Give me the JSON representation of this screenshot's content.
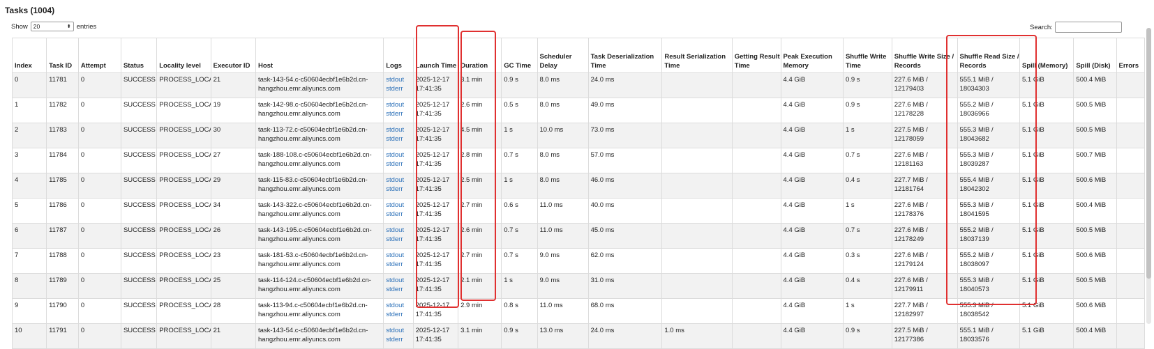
{
  "title": "Tasks (1004)",
  "show_label": "Show",
  "page_size": "20",
  "entries_label": "entries",
  "search_label": "Search:",
  "search_value": "",
  "columns": [
    "Index",
    "Task ID",
    "Attempt",
    "Status",
    "Locality level",
    "Executor ID",
    "Host",
    "Logs",
    "Launch Time",
    "Duration",
    "GC Time",
    "Scheduler Delay",
    "Task Deserialization Time",
    "Result Serialization Time",
    "Getting Result Time",
    "Peak Execution Memory",
    "Shuffle Write Time",
    "Shuffle Write Size / Records",
    "Shuffle Read Size / Records",
    "Spill (Memory)",
    "Spill (Disk)",
    "Errors"
  ],
  "rows": [
    {
      "index": "0",
      "task_id": "11781",
      "attempt": "0",
      "status": "SUCCESS",
      "locality": "PROCESS_LOCAL",
      "executor": "21",
      "host": "task-143-54.c-c50604ecbf1e6b2d.cn-hangzhou.emr.aliyuncs.com",
      "stdout": "stdout",
      "stderr": "stderr",
      "launch": "2025-12-17 17:41:35",
      "duration": "3.1 min",
      "gc": "0.9 s",
      "sched": "8.0 ms",
      "deser": "24.0 ms",
      "resser": "",
      "getting": "",
      "peak": "4.4 GiB",
      "swtime": "0.9 s",
      "swsize": "227.6 MiB / 12179403",
      "srsize": "555.1 MiB / 18034303",
      "spillmem": "5.1 GiB",
      "spilldisk": "500.4 MiB",
      "errors": ""
    },
    {
      "index": "1",
      "task_id": "11782",
      "attempt": "0",
      "status": "SUCCESS",
      "locality": "PROCESS_LOCAL",
      "executor": "19",
      "host": "task-142-98.c-c50604ecbf1e6b2d.cn-hangzhou.emr.aliyuncs.com",
      "stdout": "stdout",
      "stderr": "stderr",
      "launch": "2025-12-17 17:41:35",
      "duration": "2.6 min",
      "gc": "0.5 s",
      "sched": "8.0 ms",
      "deser": "49.0 ms",
      "resser": "",
      "getting": "",
      "peak": "4.4 GiB",
      "swtime": "0.9 s",
      "swsize": "227.6 MiB / 12178228",
      "srsize": "555.2 MiB / 18036966",
      "spillmem": "5.1 GiB",
      "spilldisk": "500.5 MiB",
      "errors": ""
    },
    {
      "index": "2",
      "task_id": "11783",
      "attempt": "0",
      "status": "SUCCESS",
      "locality": "PROCESS_LOCAL",
      "executor": "30",
      "host": "task-113-72.c-c50604ecbf1e6b2d.cn-hangzhou.emr.aliyuncs.com",
      "stdout": "stdout",
      "stderr": "stderr",
      "launch": "2025-12-17 17:41:35",
      "duration": "4.5 min",
      "gc": "1 s",
      "sched": "10.0 ms",
      "deser": "73.0 ms",
      "resser": "",
      "getting": "",
      "peak": "4.4 GiB",
      "swtime": "1 s",
      "swsize": "227.5 MiB / 12178059",
      "srsize": "555.3 MiB / 18043682",
      "spillmem": "5.1 GiB",
      "spilldisk": "500.5 MiB",
      "errors": ""
    },
    {
      "index": "3",
      "task_id": "11784",
      "attempt": "0",
      "status": "SUCCESS",
      "locality": "PROCESS_LOCAL",
      "executor": "27",
      "host": "task-188-108.c-c50604ecbf1e6b2d.cn-hangzhou.emr.aliyuncs.com",
      "stdout": "stdout",
      "stderr": "stderr",
      "launch": "2025-12-17 17:41:35",
      "duration": "2.8 min",
      "gc": "0.7 s",
      "sched": "8.0 ms",
      "deser": "57.0 ms",
      "resser": "",
      "getting": "",
      "peak": "4.4 GiB",
      "swtime": "0.7 s",
      "swsize": "227.6 MiB / 12181163",
      "srsize": "555.3 MiB / 18039287",
      "spillmem": "5.1 GiB",
      "spilldisk": "500.7 MiB",
      "errors": ""
    },
    {
      "index": "4",
      "task_id": "11785",
      "attempt": "0",
      "status": "SUCCESS",
      "locality": "PROCESS_LOCAL",
      "executor": "29",
      "host": "task-115-83.c-c50604ecbf1e6b2d.cn-hangzhou.emr.aliyuncs.com",
      "stdout": "stdout",
      "stderr": "stderr",
      "launch": "2025-12-17 17:41:35",
      "duration": "2.5 min",
      "gc": "1 s",
      "sched": "8.0 ms",
      "deser": "46.0 ms",
      "resser": "",
      "getting": "",
      "peak": "4.4 GiB",
      "swtime": "0.4 s",
      "swsize": "227.7 MiB / 12181764",
      "srsize": "555.4 MiB / 18042302",
      "spillmem": "5.1 GiB",
      "spilldisk": "500.6 MiB",
      "errors": ""
    },
    {
      "index": "5",
      "task_id": "11786",
      "attempt": "0",
      "status": "SUCCESS",
      "locality": "PROCESS_LOCAL",
      "executor": "34",
      "host": "task-143-322.c-c50604ecbf1e6b2d.cn-hangzhou.emr.aliyuncs.com",
      "stdout": "stdout",
      "stderr": "stderr",
      "launch": "2025-12-17 17:41:35",
      "duration": "2.7 min",
      "gc": "0.6 s",
      "sched": "11.0 ms",
      "deser": "40.0 ms",
      "resser": "",
      "getting": "",
      "peak": "4.4 GiB",
      "swtime": "1 s",
      "swsize": "227.6 MiB / 12178376",
      "srsize": "555.3 MiB / 18041595",
      "spillmem": "5.1 GiB",
      "spilldisk": "500.4 MiB",
      "errors": ""
    },
    {
      "index": "6",
      "task_id": "11787",
      "attempt": "0",
      "status": "SUCCESS",
      "locality": "PROCESS_LOCAL",
      "executor": "26",
      "host": "task-143-195.c-c50604ecbf1e6b2d.cn-hangzhou.emr.aliyuncs.com",
      "stdout": "stdout",
      "stderr": "stderr",
      "launch": "2025-12-17 17:41:35",
      "duration": "2.6 min",
      "gc": "0.7 s",
      "sched": "11.0 ms",
      "deser": "45.0 ms",
      "resser": "",
      "getting": "",
      "peak": "4.4 GiB",
      "swtime": "0.7 s",
      "swsize": "227.6 MiB / 12178249",
      "srsize": "555.2 MiB / 18037139",
      "spillmem": "5.1 GiB",
      "spilldisk": "500.5 MiB",
      "errors": ""
    },
    {
      "index": "7",
      "task_id": "11788",
      "attempt": "0",
      "status": "SUCCESS",
      "locality": "PROCESS_LOCAL",
      "executor": "23",
      "host": "task-181-53.c-c50604ecbf1e6b2d.cn-hangzhou.emr.aliyuncs.com",
      "stdout": "stdout",
      "stderr": "stderr",
      "launch": "2025-12-17 17:41:35",
      "duration": "2.7 min",
      "gc": "0.7 s",
      "sched": "9.0 ms",
      "deser": "62.0 ms",
      "resser": "",
      "getting": "",
      "peak": "4.4 GiB",
      "swtime": "0.3 s",
      "swsize": "227.6 MiB / 12179124",
      "srsize": "555.2 MiB / 18038097",
      "spillmem": "5.1 GiB",
      "spilldisk": "500.6 MiB",
      "errors": ""
    },
    {
      "index": "8",
      "task_id": "11789",
      "attempt": "0",
      "status": "SUCCESS",
      "locality": "PROCESS_LOCAL",
      "executor": "25",
      "host": "task-114-124.c-c50604ecbf1e6b2d.cn-hangzhou.emr.aliyuncs.com",
      "stdout": "stdout",
      "stderr": "stderr",
      "launch": "2025-12-17 17:41:35",
      "duration": "2.1 min",
      "gc": "1 s",
      "sched": "9.0 ms",
      "deser": "31.0 ms",
      "resser": "",
      "getting": "",
      "peak": "4.4 GiB",
      "swtime": "0.4 s",
      "swsize": "227.6 MiB / 12179911",
      "srsize": "555.3 MiB / 18040573",
      "spillmem": "5.1 GiB",
      "spilldisk": "500.5 MiB",
      "errors": ""
    },
    {
      "index": "9",
      "task_id": "11790",
      "attempt": "0",
      "status": "SUCCESS",
      "locality": "PROCESS_LOCAL",
      "executor": "28",
      "host": "task-113-94.c-c50604ecbf1e6b2d.cn-hangzhou.emr.aliyuncs.com",
      "stdout": "stdout",
      "stderr": "stderr",
      "launch": "2025-12-17 17:41:35",
      "duration": "2.9 min",
      "gc": "0.8 s",
      "sched": "11.0 ms",
      "deser": "68.0 ms",
      "resser": "",
      "getting": "",
      "peak": "4.4 GiB",
      "swtime": "1 s",
      "swsize": "227.7 MiB / 12182997",
      "srsize": "555.3 MiB / 18038542",
      "spillmem": "5.1 GiB",
      "spilldisk": "500.6 MiB",
      "errors": ""
    },
    {
      "index": "10",
      "task_id": "11791",
      "attempt": "0",
      "status": "SUCCESS",
      "locality": "PROCESS_LOCAL",
      "executor": "21",
      "host": "task-143-54.c-c50604ecbf1e6b2d.cn-hangzhou.emr.aliyuncs.com",
      "stdout": "stdout",
      "stderr": "stderr",
      "launch": "2025-12-17 17:41:35",
      "duration": "3.1 min",
      "gc": "0.9 s",
      "sched": "13.0 ms",
      "deser": "24.0 ms",
      "resser": "1.0 ms",
      "getting": "",
      "peak": "4.4 GiB",
      "swtime": "0.9 s",
      "swsize": "227.5 MiB / 12177386",
      "srsize": "555.1 MiB / 18033576",
      "spillmem": "5.1 GiB",
      "spilldisk": "500.4 MiB",
      "errors": ""
    }
  ]
}
